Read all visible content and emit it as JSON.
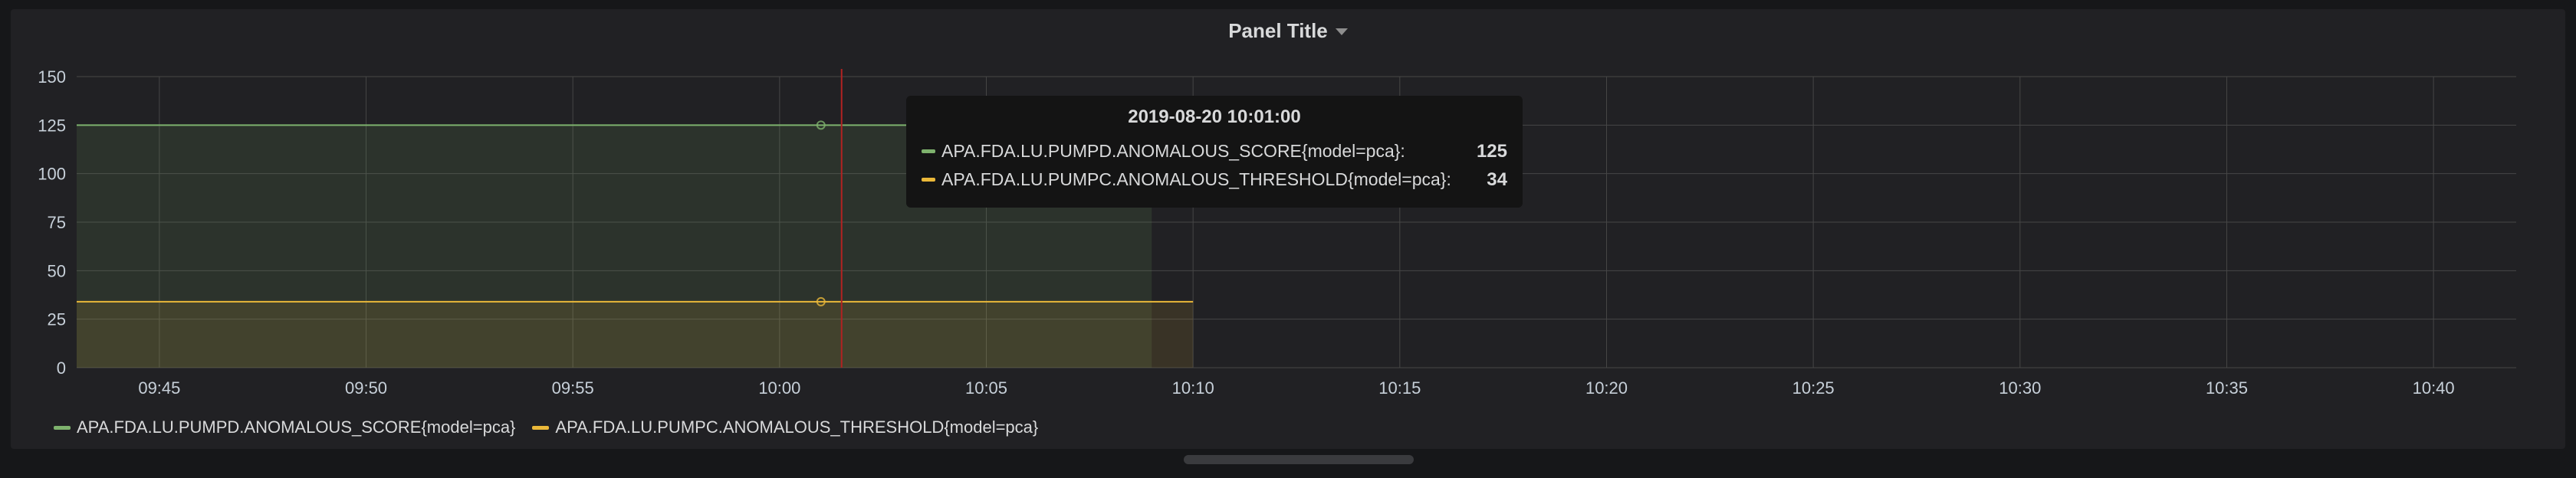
{
  "panel": {
    "title": "Panel Title"
  },
  "chart_data": {
    "type": "area",
    "x_ticks": [
      "09:45",
      "09:50",
      "09:55",
      "10:00",
      "10:05",
      "10:10",
      "10:15",
      "10:20",
      "10:25",
      "10:30",
      "10:35",
      "10:40"
    ],
    "xlim": [
      "09:43",
      "10:42"
    ],
    "ylim": [
      0,
      150
    ],
    "y_ticks": [
      0,
      25,
      50,
      75,
      100,
      125,
      150
    ],
    "grid": true,
    "legend_position": "bottom-left",
    "hover_time": "10:01:30",
    "series": [
      {
        "name": "APA.FDA.LU.PUMPD.ANOMALOUS_SCORE{model=pca}",
        "color": "#7eb26d",
        "start": "09:43",
        "end": "10:10",
        "fill_end": "10:09",
        "value": 125
      },
      {
        "name": "APA.FDA.LU.PUMPC.ANOMALOUS_THRESHOLD{model=pca}",
        "color": "#eab839",
        "start": "09:43",
        "end": "10:10",
        "fill_end": "10:10",
        "value": 34
      }
    ]
  },
  "tooltip": {
    "time": "2019-08-20 10:01:00",
    "rows": [
      {
        "series": "APA.FDA.LU.PUMPD.ANOMALOUS_SCORE{model=pca}:",
        "value": "125",
        "color": "#7eb26d"
      },
      {
        "series": "APA.FDA.LU.PUMPC.ANOMALOUS_THRESHOLD{model=pca}:",
        "value": "34",
        "color": "#eab839"
      }
    ]
  },
  "colors": {
    "grid": "#464646",
    "crosshair": "#b22222",
    "panel_bg": "#212124"
  }
}
